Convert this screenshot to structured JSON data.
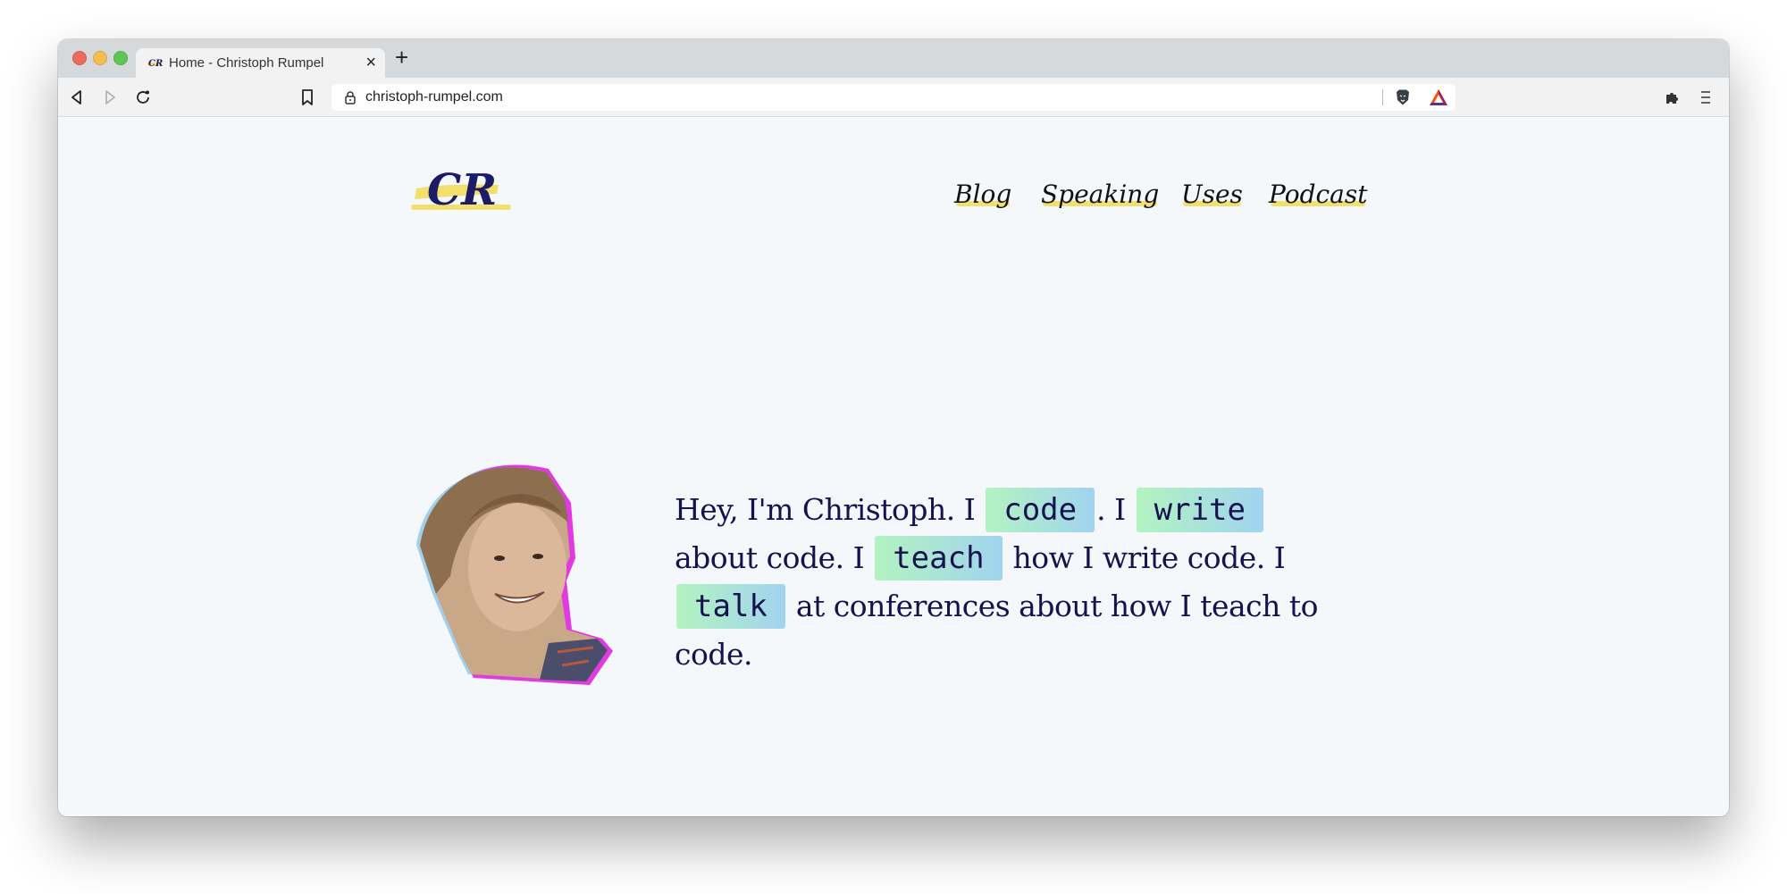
{
  "browser": {
    "tab": {
      "title": "Home - Christoph Rumpel",
      "close_label": "×",
      "favicon": "cr-logo-icon"
    },
    "new_tab_label": "+",
    "toolbar": {
      "back_icon": "back-arrow-icon",
      "forward_icon": "forward-arrow-icon",
      "reload_icon": "reload-icon",
      "bookmark_icon": "bookmark-icon",
      "extensions_icon": "puzzle-icon",
      "menu_icon": "hamburger-menu-icon"
    },
    "address_bar": {
      "url": "christoph-rumpel.com",
      "lock_icon": "lock-icon",
      "brave_shield_icon": "brave-lion-icon",
      "rewards_icon": "bat-triangle-icon"
    }
  },
  "site": {
    "logo_text": "CR",
    "nav": [
      {
        "label": "Blog"
      },
      {
        "label": "Speaking"
      },
      {
        "label": "Uses"
      },
      {
        "label": "Podcast"
      }
    ],
    "accent_colors": {
      "highlight_yellow": "#f3df6d",
      "badge_green": "#b3f3c0",
      "badge_blue": "#a1d3ef",
      "text_navy": "#14124f",
      "background": "#f5f8fb"
    },
    "hero": {
      "t1": "Hey, I'm Christoph. I ",
      "b1": "code",
      "t2": ". I ",
      "b2": "write",
      "t3": " about code. I ",
      "b3": "teach",
      "t4": " how I write code. I ",
      "b4": "talk",
      "t5": " at conferences about how I teach to code."
    }
  }
}
